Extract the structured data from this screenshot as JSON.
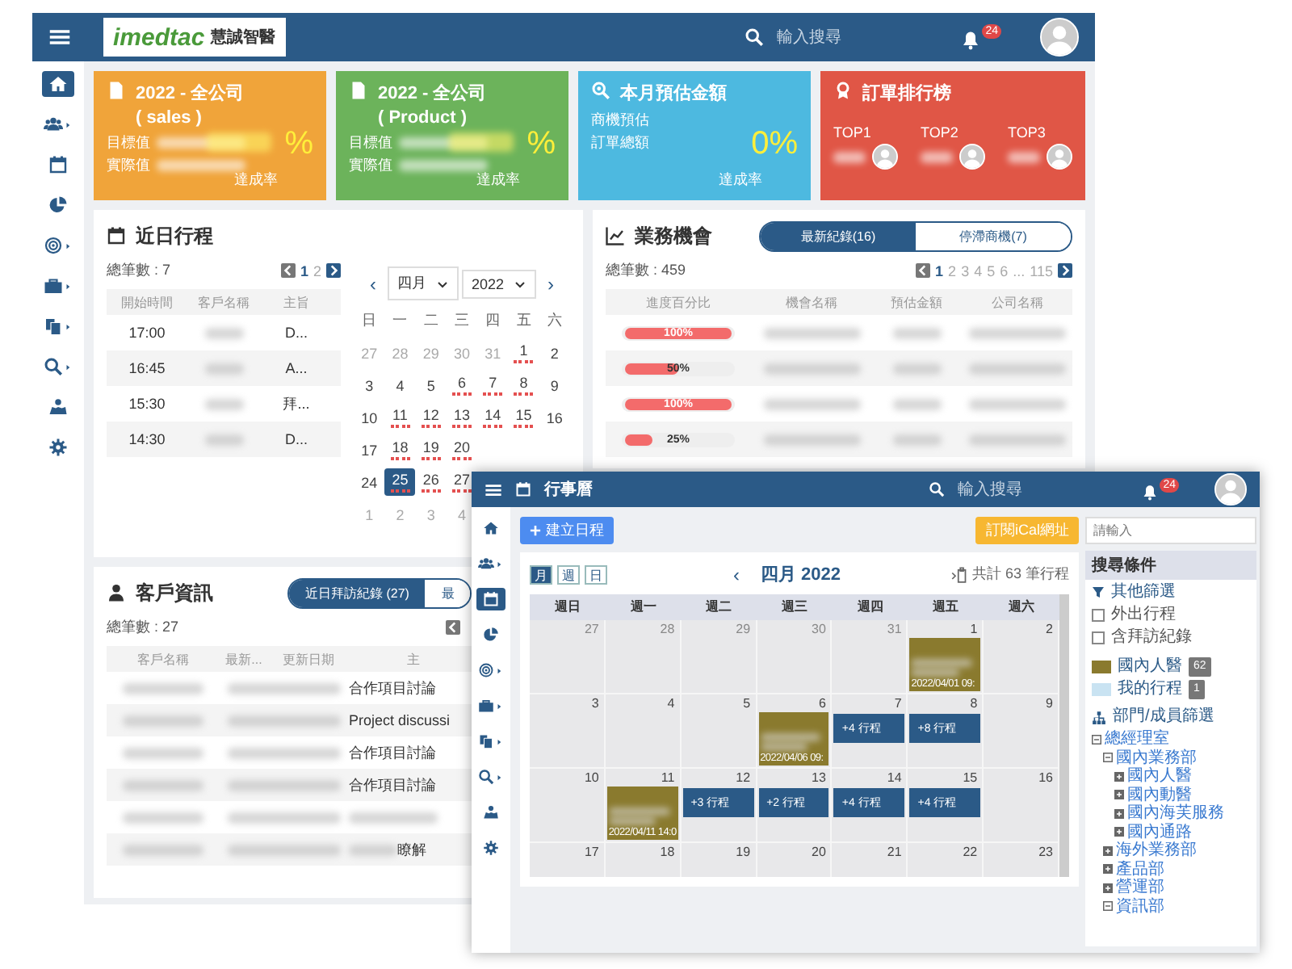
{
  "back": {
    "header": {
      "logo": "imedtac",
      "logo_name": "慧誠智醫",
      "search": {
        "placeholder": "輸入搜尋"
      },
      "notifications": "24"
    },
    "nav": [
      {
        "selected": true,
        "submenu": false
      },
      {
        "selected": false,
        "submenu": true
      },
      {
        "selected": false,
        "submenu": false
      },
      {
        "selected": false,
        "submenu": false
      },
      {
        "selected": false,
        "submenu": true
      },
      {
        "selected": false,
        "submenu": true
      },
      {
        "selected": false,
        "submenu": true
      },
      {
        "selected": false,
        "submenu": true
      },
      {
        "selected": false,
        "submenu": false
      },
      {
        "selected": false,
        "submenu": false
      }
    ],
    "cards": [
      {
        "kind": "target",
        "color": "#f0a43a",
        "title": "2022 - 全公司",
        "subtitle": "( sales )",
        "labels": [
          "目標值",
          "實際值"
        ],
        "percent": "%",
        "caption": "達成率"
      },
      {
        "kind": "target",
        "color": "#6cb35b",
        "title": "2022 - 全公司",
        "subtitle": "( Product )",
        "labels": [
          "目標值",
          "實際值"
        ],
        "percent": "%",
        "caption": "達成率"
      },
      {
        "kind": "estimate",
        "color": "#4db9e0",
        "title": "本月預估金額",
        "labels": [
          "商機預估",
          "訂單總額"
        ],
        "percent": "0%",
        "caption": "達成率"
      },
      {
        "kind": "ranking",
        "color": "#e05646",
        "title": "訂單排行榜",
        "ranks": [
          "TOP1",
          "TOP2",
          "TOP3"
        ]
      }
    ],
    "schedule": {
      "title": "近日行程",
      "total": "總筆數 : 7",
      "pages": [
        {
          "label": "1",
          "selected": true
        },
        {
          "label": "2",
          "selected": false
        }
      ],
      "columns": [
        "開始時間",
        "客戶名稱",
        "主旨"
      ],
      "rows": [
        {
          "time": "17:00",
          "subject": "D..."
        },
        {
          "time": "16:45",
          "subject": "A..."
        },
        {
          "time": "15:30",
          "subject": "拜..."
        },
        {
          "time": "14:30",
          "subject": "D..."
        }
      ],
      "calendar": {
        "prev": "‹",
        "month": "四月",
        "year": "2022",
        "next": "›",
        "weekdays": [
          "日",
          "一",
          "二",
          "三",
          "四",
          "五",
          "六"
        ],
        "weeks": [
          [
            {
              "day": "27",
              "muted": true,
              "selected": false,
              "events": false
            },
            {
              "day": "28",
              "muted": true,
              "selected": false,
              "events": false
            },
            {
              "day": "29",
              "muted": true,
              "selected": false,
              "events": false
            },
            {
              "day": "30",
              "muted": true,
              "selected": false,
              "events": false
            },
            {
              "day": "31",
              "muted": true,
              "selected": false,
              "events": false
            },
            {
              "day": "1",
              "muted": false,
              "selected": false,
              "events": true
            },
            {
              "day": "2",
              "muted": false,
              "selected": false,
              "events": false
            }
          ],
          [
            {
              "day": "3",
              "muted": false,
              "selected": false,
              "events": false
            },
            {
              "day": "4",
              "muted": false,
              "selected": false,
              "events": false
            },
            {
              "day": "5",
              "muted": false,
              "selected": false,
              "events": false
            },
            {
              "day": "6",
              "muted": false,
              "selected": false,
              "events": true
            },
            {
              "day": "7",
              "muted": false,
              "selected": false,
              "events": true
            },
            {
              "day": "8",
              "muted": false,
              "selected": false,
              "events": true
            },
            {
              "day": "9",
              "muted": false,
              "selected": false,
              "events": false
            }
          ],
          [
            {
              "day": "10",
              "muted": false,
              "selected": false,
              "events": false
            },
            {
              "day": "11",
              "muted": false,
              "selected": false,
              "events": true
            },
            {
              "day": "12",
              "muted": false,
              "selected": false,
              "events": true
            },
            {
              "day": "13",
              "muted": false,
              "selected": false,
              "events": true
            },
            {
              "day": "14",
              "muted": false,
              "selected": false,
              "events": true
            },
            {
              "day": "15",
              "muted": false,
              "selected": false,
              "events": true
            },
            {
              "day": "16",
              "muted": false,
              "selected": false,
              "events": false
            }
          ],
          [
            {
              "day": "17",
              "muted": false,
              "selected": false,
              "events": false
            },
            {
              "day": "18",
              "muted": false,
              "selected": false,
              "events": true
            },
            {
              "day": "19",
              "muted": false,
              "selected": false,
              "events": true
            },
            {
              "day": "20",
              "muted": false,
              "selected": false,
              "events": true
            }
          ],
          [
            {
              "day": "24",
              "muted": false,
              "selected": false,
              "events": false
            },
            {
              "day": "25",
              "muted": false,
              "selected": true,
              "events": true
            },
            {
              "day": "26",
              "muted": false,
              "selected": false,
              "events": true
            },
            {
              "day": "27",
              "muted": false,
              "selected": false,
              "events": true
            }
          ],
          [
            {
              "day": "1",
              "muted": true,
              "selected": false,
              "events": false
            },
            {
              "day": "2",
              "muted": true,
              "selected": false,
              "events": false
            },
            {
              "day": "3",
              "muted": true,
              "selected": false,
              "events": false
            },
            {
              "day": "4",
              "muted": true,
              "selected": false,
              "events": false
            }
          ]
        ]
      }
    },
    "opportunities": {
      "title": "業務機會",
      "tabs": [
        {
          "label": "最新紀錄(16)",
          "selected": true
        },
        {
          "label": "停滯商機(7)",
          "selected": false
        }
      ],
      "total": "總筆數 : 459",
      "pages": [
        {
          "label": "1",
          "selected": true
        },
        {
          "label": "2",
          "selected": false
        },
        {
          "label": "3",
          "selected": false
        },
        {
          "label": "4",
          "selected": false
        },
        {
          "label": "5",
          "selected": false
        },
        {
          "label": "6",
          "selected": false
        },
        {
          "label": "...",
          "selected": false
        },
        {
          "label": "115",
          "selected": false
        }
      ],
      "columns": [
        "進度百分比",
        "機會名稱",
        "預估金額",
        "公司名稱"
      ],
      "rows": [
        {
          "level": 1,
          "reading": "100%"
        },
        {
          "level": 0.5,
          "reading": "50%"
        },
        {
          "level": 1,
          "reading": "100%"
        },
        {
          "level": 0.25,
          "reading": "25%"
        }
      ]
    },
    "customers": {
      "title": "客戶資訊",
      "tabs": [
        {
          "label": "近日拜訪紀錄 (27)",
          "selected": true
        },
        {
          "label": "最",
          "selected": false
        }
      ],
      "total": "總筆數 : 27",
      "columns": [
        "客戶名稱",
        "最新...",
        "更新日期",
        "主"
      ],
      "rows": [
        {
          "subject": "合作項目討論",
          "blur_before": false
        },
        {
          "subject": "Project discussi",
          "blur_before": false
        },
        {
          "subject": "合作項目討論",
          "blur_before": false
        },
        {
          "subject": "合作項目討論",
          "blur_before": false
        },
        {
          "blur_before": true
        },
        {
          "subject": "瞭解",
          "blur_before": true
        }
      ]
    }
  },
  "front": {
    "header": {
      "title": "行事曆",
      "search": {
        "placeholder": "輸入搜尋"
      },
      "notifications": "24"
    },
    "nav": [
      {
        "selected": false,
        "submenu": false
      },
      {
        "selected": false,
        "submenu": true
      },
      {
        "selected": true,
        "submenu": false
      },
      {
        "selected": false,
        "submenu": false
      },
      {
        "selected": false,
        "submenu": true
      },
      {
        "selected": false,
        "submenu": true
      },
      {
        "selected": false,
        "submenu": true
      },
      {
        "selected": false,
        "submenu": true
      },
      {
        "selected": false,
        "submenu": false
      },
      {
        "selected": false,
        "submenu": false
      }
    ],
    "toolbar": {
      "create": "建立日程",
      "subscribe": "訂閱iCal網址"
    },
    "calendar": {
      "views": [
        {
          "label": "月",
          "selected": true
        },
        {
          "label": "週",
          "selected": false
        },
        {
          "label": "日",
          "selected": false
        }
      ],
      "prev": "‹",
      "title": "四月 2022",
      "total": "共計 63 筆行程",
      "weekdays": [
        "週日",
        "週一",
        "週二",
        "週三",
        "週四",
        "週五",
        "週六"
      ],
      "weeks": [
        [
          {
            "day": "27",
            "muted": true
          },
          {
            "day": "28",
            "muted": true
          },
          {
            "day": "29",
            "muted": true
          },
          {
            "day": "30",
            "muted": true
          },
          {
            "day": "31",
            "muted": true
          },
          {
            "day": "1",
            "muted": false,
            "event": {
              "kind": "detail",
              "color": "#8a7a2e",
              "time": "2022/04/01 09:"
            }
          },
          {
            "day": "2",
            "muted": false
          }
        ],
        [
          {
            "day": "3",
            "muted": false
          },
          {
            "day": "4",
            "muted": false
          },
          {
            "day": "5",
            "muted": false
          },
          {
            "day": "6",
            "muted": false,
            "event": {
              "kind": "detail",
              "color": "#8a7a2e",
              "time": "2022/04/06 09:"
            }
          },
          {
            "day": "7",
            "muted": false,
            "event": {
              "kind": "more",
              "label": "+4 行程"
            }
          },
          {
            "day": "8",
            "muted": false,
            "event": {
              "kind": "more",
              "label": "+8 行程"
            }
          },
          {
            "day": "9",
            "muted": false
          }
        ],
        [
          {
            "day": "10",
            "muted": false
          },
          {
            "day": "11",
            "muted": false,
            "event": {
              "kind": "detail",
              "color": "#8a7a2e",
              "time": "2022/04/11 14:0"
            }
          },
          {
            "day": "12",
            "muted": false,
            "event": {
              "kind": "more",
              "label": "+3 行程"
            }
          },
          {
            "day": "13",
            "muted": false,
            "event": {
              "kind": "more",
              "label": "+2 行程"
            }
          },
          {
            "day": "14",
            "muted": false,
            "event": {
              "kind": "more",
              "label": "+4 行程"
            }
          },
          {
            "day": "15",
            "muted": false,
            "event": {
              "kind": "more",
              "label": "+4 行程"
            }
          },
          {
            "day": "16",
            "muted": false
          }
        ],
        [
          {
            "day": "17",
            "muted": false
          },
          {
            "day": "18",
            "muted": false
          },
          {
            "day": "19",
            "muted": false
          },
          {
            "day": "20",
            "muted": false
          },
          {
            "day": "21",
            "muted": false
          },
          {
            "day": "22",
            "muted": false
          },
          {
            "day": "23",
            "muted": false
          }
        ]
      ]
    },
    "sidebar": {
      "search": {
        "placeholder": "請輸入"
      },
      "heading": "搜尋條件",
      "filter_title": "其他篩選",
      "filters": [
        {
          "label": "外出行程",
          "checked": false
        },
        {
          "label": "含拜訪紀錄",
          "checked": false
        }
      ],
      "legend": [
        {
          "label": "國內人醫",
          "color": "#8a7a2e",
          "count": "62"
        },
        {
          "label": "我的行程",
          "color": "#c9e3f2",
          "count": "1"
        }
      ],
      "tree_title": "部門/成員篩選",
      "tree": [
        {
          "label": "總經理室",
          "expanded": true,
          "children": [
            {
              "label": "國內業務部",
              "expanded": true,
              "children": [
                {
                  "label": "國內人醫",
                  "expanded": false
                },
                {
                  "label": "國內動醫",
                  "expanded": false
                },
                {
                  "label": "國內海芙服務",
                  "expanded": false
                },
                {
                  "label": "國內通路",
                  "expanded": false
                }
              ]
            },
            {
              "label": "海外業務部",
              "expanded": false
            },
            {
              "label": "產品部",
              "expanded": false
            },
            {
              "label": "營運部",
              "expanded": false
            },
            {
              "label": "資訊部",
              "expanded": true
            }
          ]
        }
      ]
    }
  }
}
